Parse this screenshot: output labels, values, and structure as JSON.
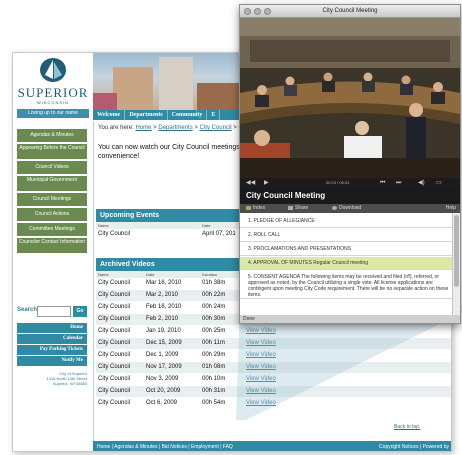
{
  "site": {
    "logo": {
      "word": "SUPERIOR",
      "sub": "WISCONSIN",
      "tag": "Loving up to our name"
    },
    "nav": [
      "Welcome",
      "Departments",
      "Community",
      "E"
    ],
    "sidebar": {
      "items": [
        "Agendas & Minutes",
        "Appearing Before the Council",
        "Council Videos",
        "Municipal Government",
        "Council Meetings",
        "Council Actions",
        "Committee Meetings",
        "Councilor Contact Information"
      ],
      "search_label": "Search",
      "search_value": "",
      "search_button": "Go",
      "links": [
        "Home",
        "Calendar",
        "Pay Parking Tickets",
        "Notify Me"
      ],
      "address": [
        "City of Superior",
        "1316 North 14th Street",
        "Superior, WI 54880"
      ]
    },
    "breadcrumb": {
      "prefix": "You are here:",
      "items": [
        "Home",
        "Departments",
        "City Council"
      ],
      "separator": ">",
      "tail": "C"
    },
    "intro_text": "You can now watch our City Council meetings convenience!",
    "upcoming": {
      "title": "Upcoming Events",
      "columns": [
        "Name",
        "Date"
      ],
      "rows": [
        {
          "name": "City Council",
          "date": "April 07, 201"
        }
      ]
    },
    "archived": {
      "title": "Archived Videos",
      "columns": [
        "Name",
        "Date",
        "Duration"
      ],
      "rows": [
        {
          "name": "City Council",
          "date": "Mar 16, 2010",
          "duration": "01h 38m",
          "link": ""
        },
        {
          "name": "City Council",
          "date": "Mar 2, 2010",
          "duration": "00h 22m",
          "link": ""
        },
        {
          "name": "City Council",
          "date": "Feb 16, 2010",
          "duration": "00h 24m",
          "link": ""
        },
        {
          "name": "City Council",
          "date": "Feb 2, 2010",
          "duration": "00h 30m",
          "link": "View Video"
        },
        {
          "name": "City Council",
          "date": "Jan 19, 2010",
          "duration": "00h 25m",
          "link": "View Video"
        },
        {
          "name": "City Council",
          "date": "Dec 15, 2009",
          "duration": "00h 11m",
          "link": "View Video"
        },
        {
          "name": "City Council",
          "date": "Dec 1, 2009",
          "duration": "00h 29m",
          "link": "View Video"
        },
        {
          "name": "City Council",
          "date": "Nov 17, 2009",
          "duration": "01h 08m",
          "link": "View Video"
        },
        {
          "name": "City Council",
          "date": "Nov 3, 2009",
          "duration": "00h 10m",
          "link": "View Video"
        },
        {
          "name": "City Council",
          "date": "Oct 20, 2009",
          "duration": "00h 31m",
          "link": "View Video"
        },
        {
          "name": "City Council",
          "date": "Oct 6, 2009",
          "duration": "00h 54m",
          "link": "View Video"
        }
      ]
    },
    "back_to_top": "Back to top.",
    "footer": {
      "links": "Home | Agendas & Minutes | Bid Notices | Employment | FAQ",
      "right": "Copyright Notices | Powered by"
    }
  },
  "player": {
    "window_title": "City Council Meeting",
    "time_readout": "00:23 / 00:31",
    "title": "City Council Meeting",
    "tabs": [
      "Index",
      "Share",
      "Download"
    ],
    "help": "Help",
    "agenda": [
      "1. PLEDGE OF ALLEGIANCE",
      "2. ROLL CALL",
      "3. PROCLAMATIONS AND PRESENTATIONS",
      "4. APPROVAL OF MINUTES  Regular Council meeting",
      "5. CONSENT AGENDA  The following items may be received and filed (r/f), referred, or approved as noted, by the Council utilizing a single vote. All license applications are contingent upon meeting City Code requirement. There will be no separate action on these items."
    ],
    "active_index": 3,
    "status": "Done"
  }
}
